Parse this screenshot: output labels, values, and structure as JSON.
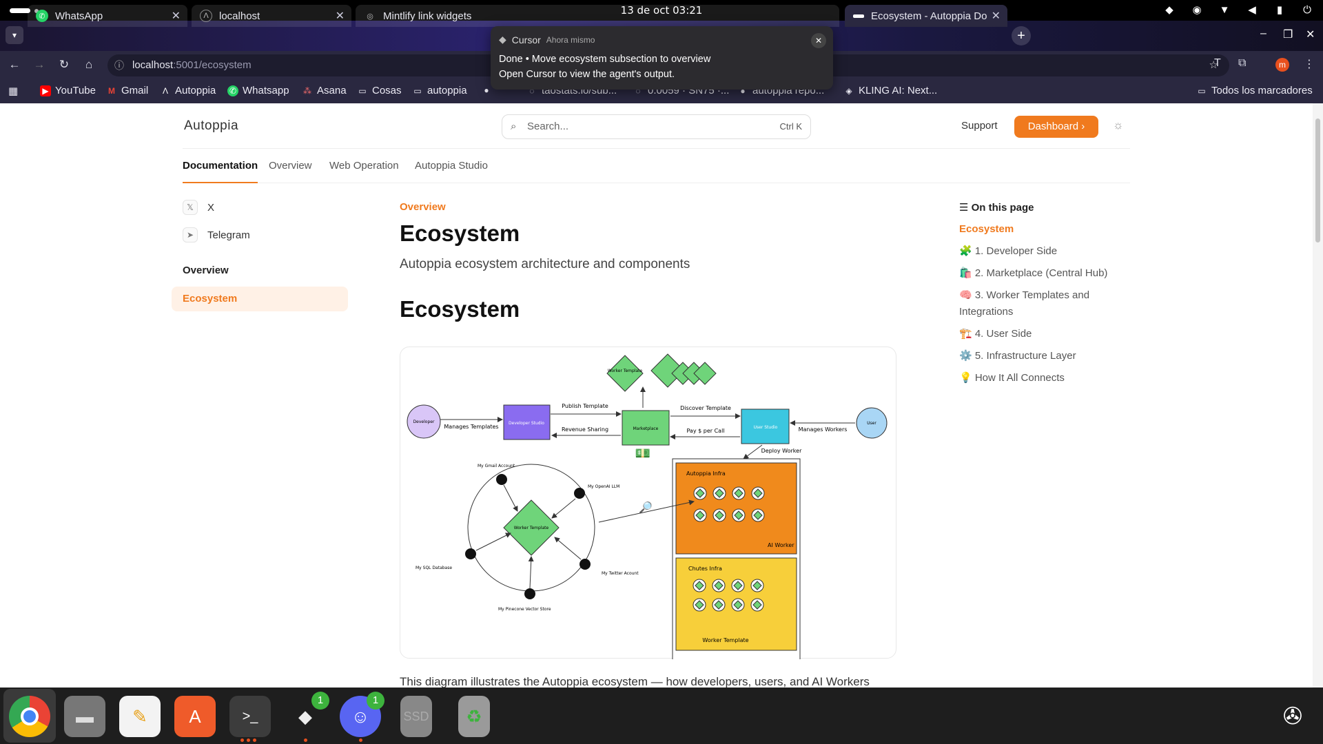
{
  "system": {
    "clock": "13 de oct  03:21",
    "tray_icons": [
      "dropbox-icon",
      "discord-icon",
      "wifi-icon",
      "volume-icon",
      "battery-icon",
      "power-icon"
    ]
  },
  "browser": {
    "tabs": [
      {
        "label": "WhatsApp",
        "icon": "whatsapp-icon",
        "color": "#25d366"
      },
      {
        "label": "localhost",
        "icon": "autoppia-icon",
        "color": "#888888"
      },
      {
        "label": "Mintlify link widgets",
        "icon": "globe-icon",
        "color": "#999999"
      },
      {
        "label": "Ecosystem - Autoppia Do",
        "icon": "page-icon",
        "color": "#ffffff"
      }
    ],
    "url_host": "localhost",
    "url_path": ":5001/ecosystem",
    "profile_initial": "m",
    "bookmarks": [
      {
        "label": "YouTube",
        "icon": "youtube-icon",
        "color": "#ff0000"
      },
      {
        "label": "Gmail",
        "icon": "gmail-icon",
        "color": "#ea4335"
      },
      {
        "label": "Autoppia",
        "icon": "autoppia-icon",
        "color": "#ffffff"
      },
      {
        "label": "Whatsapp",
        "icon": "whatsapp-icon",
        "color": "#25d366"
      },
      {
        "label": "Asana",
        "icon": "asana-icon",
        "color": "#f06a6a"
      },
      {
        "label": "Cosas",
        "icon": "folder-icon",
        "color": "#cccccc"
      },
      {
        "label": "autoppia",
        "icon": "folder-icon",
        "color": "#cccccc"
      },
      {
        "label": "taostats.io/sub...",
        "icon": "page-icon",
        "color": "#cccccc"
      },
      {
        "label": "0.0059 · SN75 ·...",
        "icon": "page-icon",
        "color": "#cccccc"
      },
      {
        "label": "autoppia repo...",
        "icon": "github-icon",
        "color": "#cccccc"
      },
      {
        "label": "KLING AI: Next...",
        "icon": "kling-icon",
        "color": "#cccccc"
      }
    ],
    "all_bookmarks": "Todos los marcadores"
  },
  "notification": {
    "app": "Cursor",
    "time": "Ahora mismo",
    "line1": "Done • Move ecosystem subsection to overview",
    "line2": "Open Cursor to view the agent's output."
  },
  "site": {
    "logo": "Autoppia",
    "search_placeholder": "Search...",
    "search_shortcut": "Ctrl K",
    "support": "Support",
    "dashboard": "Dashboard",
    "nav_tabs": [
      "Documentation",
      "Overview",
      "Web Operation",
      "Autoppia Studio"
    ],
    "sidebar": {
      "links": [
        {
          "label": "X",
          "icon": "x-icon"
        },
        {
          "label": "Telegram",
          "icon": "telegram-icon"
        }
      ],
      "group": "Overview",
      "active_item": "Ecosystem"
    },
    "breadcrumb": "Overview",
    "title": "Ecosystem",
    "subtitle": "Autoppia ecosystem architecture and components",
    "section_heading": "Ecosystem",
    "paragraph": "This diagram illustrates the Autoppia ecosystem — how developers, users, and AI Workers",
    "toc": {
      "heading": "On this page",
      "items": [
        "Ecosystem",
        "🧩 1. Developer Side",
        "🛍️ 2. Marketplace (Central Hub)",
        "🧠 3. Worker Templates and Integrations",
        "🏗️ 4. User Side",
        "⚙️ 5. Infrastructure Layer",
        "💡 How It All Connects"
      ]
    },
    "diagram": {
      "worker_template_top": "Worker Template",
      "developer": "Developer",
      "developer_studio": "Developer Studio",
      "marketplace": "Marketplace",
      "user_studio": "User Studio",
      "user": "User",
      "publish_template": "Publish Template",
      "revenue_sharing": "Revenue Sharing",
      "manages_templates": "Manages Templates",
      "discover_template": "Discover Template",
      "pay_per_call": "Pay $ per Call",
      "manages_workers": "Manages Workers",
      "deploy_worker": "Deploy Worker",
      "autoppia_infra": "Autoppia Infra",
      "ai_worker": "AI Worker",
      "chutes_infra": "Chutes Infra",
      "worker_template_bottom": "Worker Template",
      "worker_template_center": "Worker Template",
      "my_gmail": "My Gmail Account",
      "my_openai": "My OpenAI LLM",
      "my_sql": "My SQL Database",
      "my_twitter": "My Twitter Acount",
      "my_pinecone": "My Pinecone Vector Store"
    }
  },
  "dock": {
    "apps": [
      "chrome-icon",
      "files-icon",
      "text-editor-icon",
      "app-center-icon",
      "terminal-icon",
      "cursor-icon",
      "discord-icon",
      "ssd-icon",
      "trash-icon",
      "show-apps-icon"
    ],
    "badges": {
      "cursor": "1",
      "discord": "1"
    },
    "ssd_label": "SSD"
  }
}
